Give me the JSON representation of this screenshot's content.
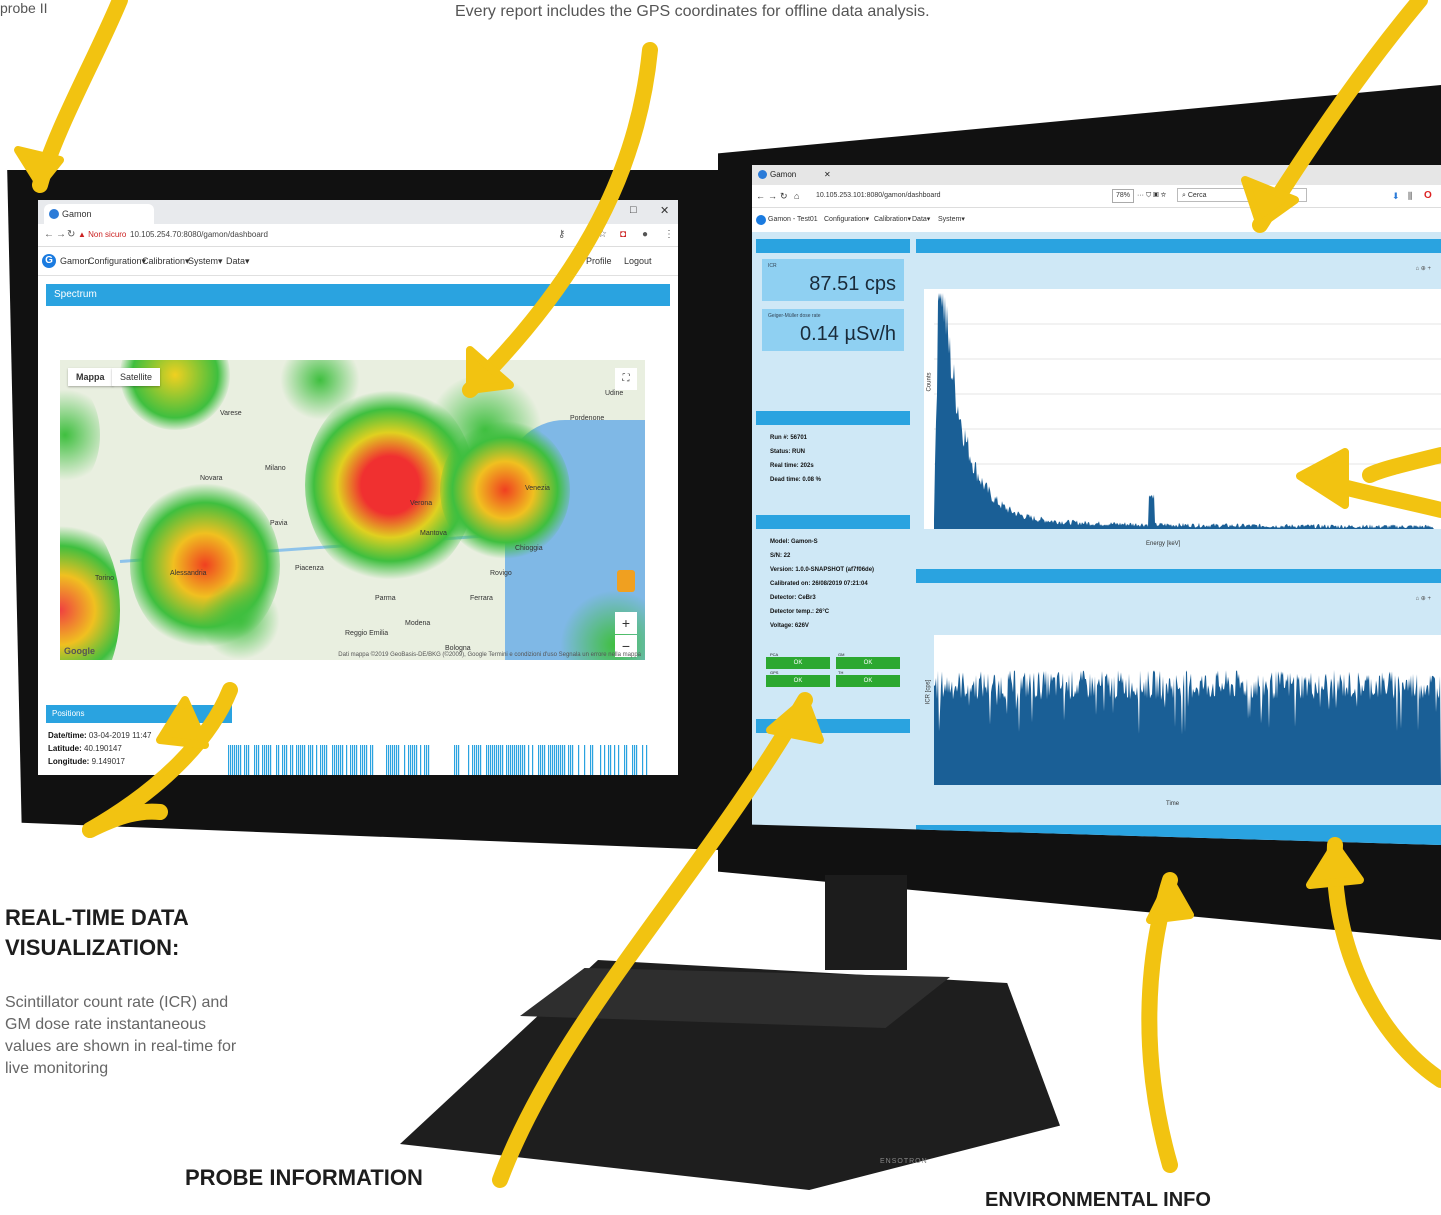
{
  "captions": {
    "top_left_fragment": "probe II",
    "top_center": "Every report includes the GPS coordinates for offline data analysis."
  },
  "realtime": {
    "heading_line1": "REAL-TIME DATA",
    "heading_line2": "VISUALIZATION:",
    "body_line1": "Scintillator count rate (ICR) and",
    "body_line2": "GM dose rate instantaneous",
    "body_line3": "values are shown in real-time for",
    "body_line4": "live monitoring"
  },
  "probe_info": {
    "heading": "PROBE INFORMATION"
  },
  "environmental": {
    "heading_fragment": "ENVIRONMENTAL INFO"
  },
  "colors": {
    "arrow": "#f2c311",
    "accent": "#2aa3e0",
    "ok": "#2ca830"
  },
  "left_screen": {
    "tab_title": "Gamon",
    "window_controls": [
      "–",
      "□",
      "✕"
    ],
    "url_warning": "▲ Non sicuro",
    "url": "10.105.254.70:8080/gamon/dashboard",
    "nav": [
      "Configuration▾",
      "Calibration▾",
      "System▾",
      "Data▾"
    ],
    "nav_right": [
      "Profile",
      "Logout"
    ],
    "app_name": "Gamon",
    "panel_title": "Spectrum",
    "map_buttons": [
      "Mappa",
      "Satellite"
    ],
    "cities": [
      "Udine",
      "Pordenone",
      "Varese",
      "Milano",
      "Novara",
      "Pavia",
      "Mantova",
      "Parma",
      "Modena",
      "Ferrara",
      "Rovigo",
      "Chioggia",
      "Bologna",
      "Verona",
      "Torino",
      "Alessandria",
      "Reggio Emilia",
      "Piacenza",
      "Venezia"
    ],
    "google": "Google",
    "map_attribution": "Dati mappa ©2019 GeoBasis-DE/BKG (©2009), Google   Termini e condizioni d'uso   Segnala un errore nella mappa",
    "positions_title": "Positions",
    "datetime_label": "Date/time:",
    "datetime_value": "03-04-2019 11:47",
    "latitude_label": "Latitude:",
    "latitude_value": "40.190147",
    "longitude_label": "Longitude:",
    "longitude_value": "9.149017"
  },
  "right_screen": {
    "tab_title": "Gamon",
    "url": "10.105.253.101:8080/gamon/dashboard",
    "zoom": "78%",
    "search_placeholder": "Cerca",
    "nav": [
      "Gamon - Test01",
      "Configuration▾",
      "Calibration▾",
      "Data▾",
      "System▾"
    ],
    "icr_label": "ICR",
    "icr_value": "87.51 cps",
    "gm_label": "Geiger-Müller dose rate",
    "gm_value": "0.14 µSv/h",
    "run_lines": [
      "Run #: 56701",
      "Status: RUN",
      "Real time: 202s",
      "Dead time: 0.08 %"
    ],
    "probe_lines": [
      "Model: Gamon-S",
      "S/N: 22",
      "Version: 1.0.0-SNAPSHOT (af7f06de)",
      "Calibrated on: 26/08/2019 07:21:04",
      "Detector: CeBr3",
      "Detector temp.: 26°C",
      "Voltage: 626V"
    ],
    "status_buttons": [
      "OK",
      "OK",
      "OK",
      "OK"
    ],
    "status_labels": [
      "PCA",
      "GM",
      "GPS",
      "TH"
    ],
    "spectrum_xlabel": "Energy [keV]",
    "spectrum_ylabel": "Counts",
    "trend_xlabel": "Time",
    "trend_ylabel": "ICR [cps]"
  }
}
